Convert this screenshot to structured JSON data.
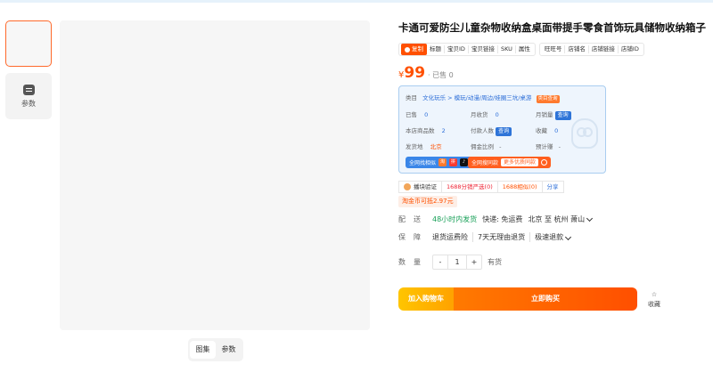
{
  "gallery": {
    "params_label": "参数",
    "tabs": [
      "图集",
      "参数"
    ]
  },
  "product": {
    "title": "卡通可爱防尘儿童杂物收纳盒桌面带提手零食首饰玩具储物收纳箱子",
    "tools": {
      "copy_label": "复制",
      "group1": [
        "标题",
        "宝贝ID",
        "宝贝链接",
        "SKU",
        "属性"
      ],
      "group2": [
        "旺旺号",
        "店铺名",
        "店铺链接",
        "店铺ID"
      ]
    },
    "price": {
      "currency": "¥",
      "value": "99",
      "sold": "· 已售 0"
    }
  },
  "panel": {
    "category_label": "类目",
    "category_path": "文化玩乐 > 模玩/动漫/周边/娃圈三坑/桌游",
    "category_badge": "类目查询",
    "sold_label": "已售",
    "sold_value": "0",
    "monthly_label": "月收货",
    "monthly_value": "0",
    "monthly_sales_label": "月销量",
    "query": "查询",
    "shop_items_label": "本店商品数",
    "shop_items_value": "2",
    "payers_label": "付款人数",
    "fav_label": "收藏",
    "fav_value": "0",
    "ship_label": "发货地",
    "ship_value": "北京",
    "commission_label": "佣金比例",
    "commission_value": "-",
    "estimate_label": "预计赚",
    "estimate_value": "-",
    "btn_find_source": "全网找相似",
    "btn_find_same": "全网搜同款",
    "btn_more": "更多优质同款"
  },
  "links": {
    "verify": "播块验证",
    "lowprice": "1688分销严选(0)",
    "similar": "1688相似(0)",
    "share": "分享"
  },
  "coin": "淘金币可抵2.97元",
  "delivery": {
    "label": "配送",
    "promise": "48小时内发货",
    "fee": "快递: 免运费",
    "route": "北京 至 杭州 萧山"
  },
  "guarantee": {
    "label": "保障",
    "items": [
      "退货运费险",
      "7天无理由退货",
      "极速退款"
    ]
  },
  "quantity": {
    "label": "数量",
    "minus": "-",
    "value": "1",
    "plus": "+",
    "stock": "有货"
  },
  "actions": {
    "cart": "加入购物车",
    "buy": "立即购买",
    "fav": "收藏"
  },
  "colors": {
    "accent": "#ff5000",
    "panel_border": "#a9cdf0",
    "link_blue": "#2e6fd8",
    "green": "#18a058"
  }
}
